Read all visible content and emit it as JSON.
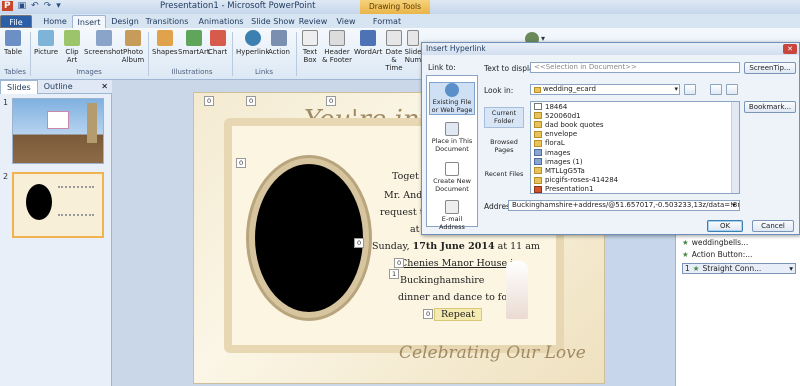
{
  "window": {
    "title": "Presentation1 - Microsoft PowerPoint",
    "contextual_tab": "Drawing Tools"
  },
  "tabs": [
    "File",
    "Home",
    "Insert",
    "Design",
    "Transitions",
    "Animations",
    "Slide Show",
    "Review",
    "View",
    "Format"
  ],
  "ribbon": {
    "groups": [
      {
        "name": "Tables",
        "items": [
          "Table"
        ]
      },
      {
        "name": "Images",
        "items": [
          "Picture",
          "Clip Art",
          "Screenshot",
          "Photo Album"
        ]
      },
      {
        "name": "Illustrations",
        "items": [
          "Shapes",
          "SmartArt",
          "Chart"
        ]
      },
      {
        "name": "Links",
        "items": [
          "Hyperlink",
          "Action"
        ]
      },
      {
        "name": "",
        "items": [
          "Text Box",
          "Header & Footer",
          "WordArt",
          "Date & Time",
          "Slide Num"
        ]
      }
    ]
  },
  "left_pane": {
    "tabs": [
      "Slides",
      "Outline"
    ],
    "slide_numbers": [
      "1",
      "2"
    ]
  },
  "slide": {
    "script_title": "You're inv",
    "lines": [
      "Toget",
      "Mr. And",
      "request the",
      "at",
      "Sunday, ",
      "17th June 2014",
      " at 11 am",
      "Chenies Manor House in",
      "Buckinghamshire",
      "dinner and dance to follow"
    ],
    "repeat_label": "Repeat",
    "footer_script": "Celebrating Our Love",
    "badges": [
      "0",
      "0",
      "0",
      "0",
      "0",
      "0",
      "1",
      "0"
    ]
  },
  "right_pane": {
    "items": [
      "weddingbells...",
      "Action Button:...",
      "Straight Conn..."
    ],
    "item_number": "1"
  },
  "dialog": {
    "title": "Insert Hyperlink",
    "link_to_label": "Link to:",
    "text_to_display_label": "Text to display:",
    "text_to_display_value": "<<Selection in Document>>",
    "screentip_label": "ScreenTip...",
    "look_in_label": "Look in:",
    "look_in_value": "wedding_ecard",
    "bookmark_label": "Bookmark...",
    "link_types": [
      "Existing File or Web Page",
      "Place in This Document",
      "Create New Document",
      "E-mail Address"
    ],
    "side_buttons": [
      "Current Folder",
      "Browsed Pages",
      "Recent Files"
    ],
    "files": [
      {
        "name": "18464",
        "type": "file"
      },
      {
        "name": "520060d1",
        "type": "folder"
      },
      {
        "name": "dad book quotes",
        "type": "folder"
      },
      {
        "name": "envelope",
        "type": "folder"
      },
      {
        "name": "floraL",
        "type": "folder"
      },
      {
        "name": "images",
        "type": "img"
      },
      {
        "name": "images (1)",
        "type": "img"
      },
      {
        "name": "MTLLgG5Ta",
        "type": "folder"
      },
      {
        "name": "picgifs-roses-414284",
        "type": "folder"
      },
      {
        "name": "Presentation1",
        "type": "pptx"
      }
    ],
    "address_label": "Address:",
    "address_value": "Buckinghamshire+address/@51.657017,-0.503233,13z/data=!3m1!4b1",
    "ok_label": "OK",
    "cancel_label": "Cancel"
  }
}
